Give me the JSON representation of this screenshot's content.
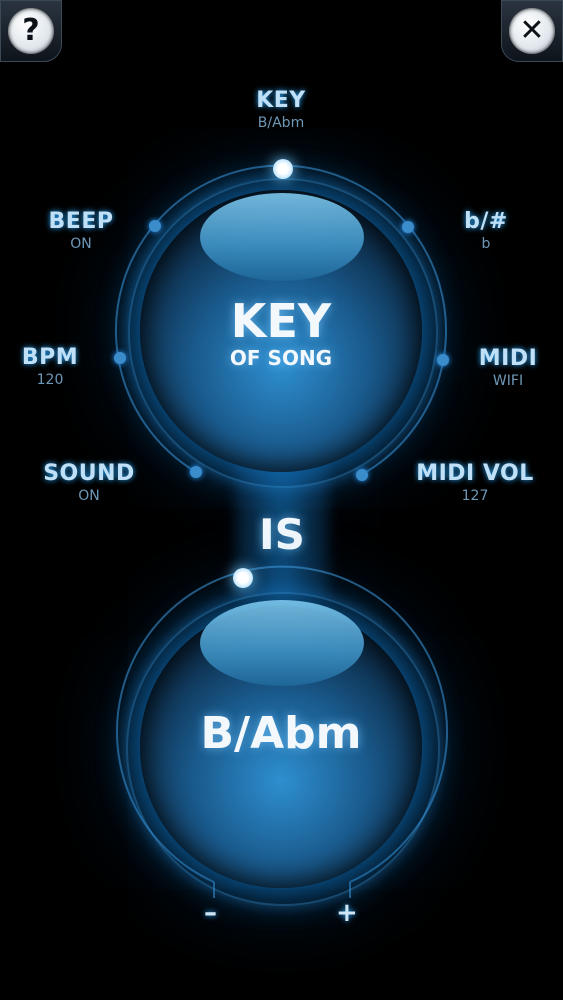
{
  "help_button": {
    "glyph": "?"
  },
  "close_button": {
    "glyph": "✕"
  },
  "options": {
    "key": {
      "label": "KEY",
      "value": "B/Abm"
    },
    "flat_sharp": {
      "label": "b/#",
      "value": "b"
    },
    "midi": {
      "label": "MIDI",
      "value": "WIFI"
    },
    "midi_vol": {
      "label": "MIDI VOL",
      "value": "127"
    },
    "beep": {
      "label": "BEEP",
      "value": "ON"
    },
    "bpm": {
      "label": "BPM",
      "value": "120"
    },
    "sound": {
      "label": "SOUND",
      "value": "ON"
    }
  },
  "top_dial": {
    "title": "KEY",
    "subtitle": "OF SONG"
  },
  "connector": "IS",
  "bottom_dial": {
    "value": "B/Abm"
  },
  "controls": {
    "minus": "–",
    "plus": "+"
  },
  "colors": {
    "accent": "#2b9cff",
    "background": "#000000"
  }
}
